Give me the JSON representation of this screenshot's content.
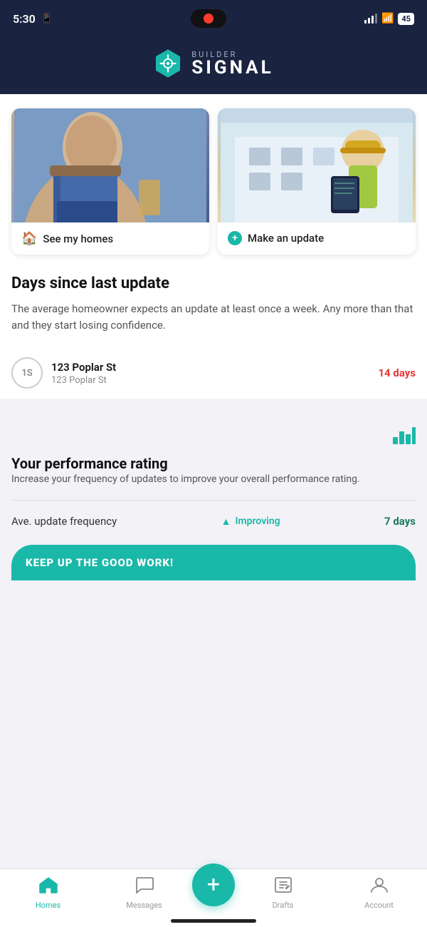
{
  "statusBar": {
    "time": "5:30",
    "batteryLevel": "45"
  },
  "header": {
    "builderLabel": "BUILDER",
    "signalLabel": "SIGNAL"
  },
  "actionCards": [
    {
      "label": "See my homes",
      "icon": "🏠"
    },
    {
      "label": "Make an update",
      "icon": "➕"
    }
  ],
  "daysSinceUpdate": {
    "title": "Days since last update",
    "description": "The average homeowner expects an update at least once a week. Any more than that and they start losing confidence.",
    "properties": [
      {
        "initials": "1S",
        "name": "123 Poplar St",
        "address": "123 Poplar St",
        "days": "14 days"
      }
    ]
  },
  "performanceRating": {
    "title": "Your performance rating",
    "description": "Increase your frequency of updates to improve your overall performance rating.",
    "metrics": [
      {
        "label": "Ave. update frequency",
        "status": "Improving",
        "value": "7 days"
      }
    ]
  },
  "banner": {
    "text": "KEEP UP THE GOOD WORK!"
  },
  "bottomNav": {
    "items": [
      {
        "label": "Homes",
        "icon": "🏠",
        "active": true
      },
      {
        "label": "Messages",
        "icon": "💬",
        "active": false
      },
      {
        "label": "",
        "icon": "+",
        "isAdd": true
      },
      {
        "label": "Drafts",
        "icon": "✏️",
        "active": false
      },
      {
        "label": "Account",
        "icon": "👤",
        "active": false
      }
    ]
  },
  "colors": {
    "teal": "#1ab8a8",
    "navy": "#1a2340",
    "red": "#e8383a",
    "green": "#1a7a5a"
  }
}
